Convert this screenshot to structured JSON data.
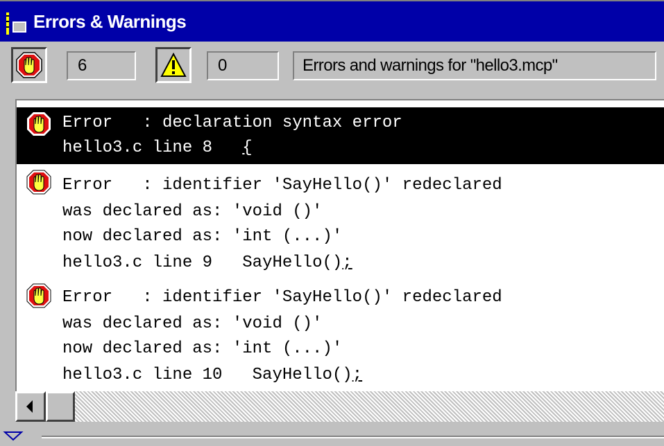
{
  "window": {
    "title": "Errors & Warnings"
  },
  "toolbar": {
    "error_count": "6",
    "warning_count": "0",
    "status_text": "Errors and warnings for \"hello3.mcp\""
  },
  "messages": [
    {
      "type": "error",
      "selected": true,
      "lines": [
        "Error   : declaration syntax error"
      ],
      "location": "hello3.c line 8",
      "source": "",
      "caret": "{"
    },
    {
      "type": "error",
      "selected": false,
      "lines": [
        "Error   : identifier 'SayHello()' redeclared",
        "was declared as: 'void ()'",
        "now declared as: 'int (...)'"
      ],
      "location": "hello3.c line 9",
      "source": "SayHello()",
      "caret": ";"
    },
    {
      "type": "error",
      "selected": false,
      "lines": [
        "Error   : identifier 'SayHello()' redeclared",
        "was declared as: 'void ()'",
        "now declared as: 'int (...)'"
      ],
      "location": "hello3.c line 10",
      "source": "SayHello()",
      "caret": ";"
    }
  ],
  "colors": {
    "title_bar": "#0000a8",
    "selection": "#000000",
    "error_icon": "#e01010",
    "warning_icon": "#ffff00"
  },
  "icons": {
    "window": "window-icon",
    "error": "stop-hand-icon",
    "warning": "warning-triangle-icon",
    "scroll_left": "arrow-left-icon",
    "collapse": "collapse-triangle-icon"
  }
}
